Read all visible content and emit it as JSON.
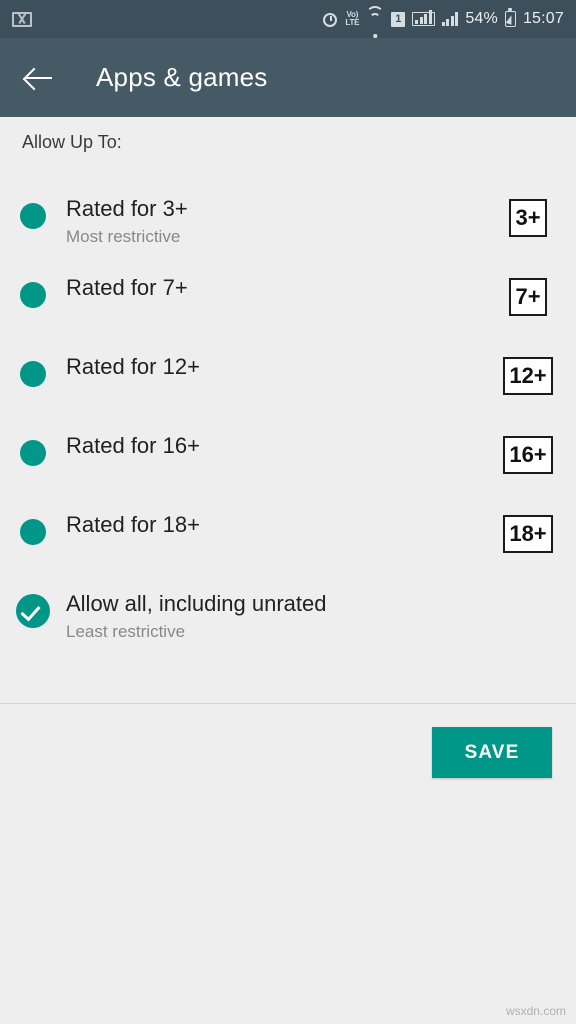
{
  "status_bar": {
    "notification_icon": "gmail-icon",
    "icons": [
      "alarm-icon",
      "volte-icon",
      "wifi-icon",
      "sim-1-icon",
      "signal-boxed-icon",
      "signal-icon"
    ],
    "volte_top": "Vo)",
    "volte_bottom": "LTE",
    "sim_label": "1",
    "battery_percent": "54%",
    "time": "15:07"
  },
  "toolbar": {
    "back_label": "back-arrow",
    "title": "Apps & games",
    "background": "#455a64"
  },
  "content": {
    "section_label": "Allow Up To:",
    "accent_color": "#009688",
    "items": [
      {
        "title": "Rated for 3+",
        "subtitle": "Most restrictive",
        "badge": "3+",
        "badge_shape": "square",
        "selected": false
      },
      {
        "title": "Rated for 7+",
        "subtitle": "",
        "badge": "7+",
        "badge_shape": "square",
        "selected": false
      },
      {
        "title": "Rated for 12+",
        "subtitle": "",
        "badge": "12+",
        "badge_shape": "wide",
        "selected": false
      },
      {
        "title": "Rated for 16+",
        "subtitle": "",
        "badge": "16+",
        "badge_shape": "wide",
        "selected": false
      },
      {
        "title": "Rated for 18+",
        "subtitle": "",
        "badge": "18+",
        "badge_shape": "wide",
        "selected": false
      },
      {
        "title": "Allow all, including unrated",
        "subtitle": "Least restrictive",
        "badge": "",
        "badge_shape": "none",
        "selected": true
      }
    ]
  },
  "footer": {
    "save_label": "SAVE",
    "save_color": "#009688"
  },
  "watermark": "wsxdn.com"
}
